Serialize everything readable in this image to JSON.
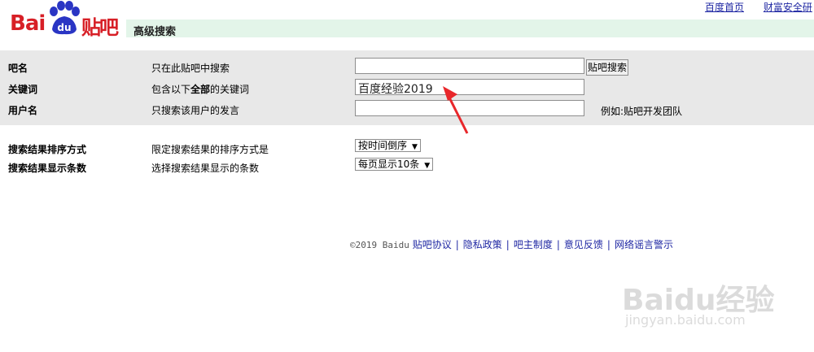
{
  "top_links": {
    "home": "百度首页",
    "security": "财富安全研"
  },
  "logo": {
    "text_left": "Bai",
    "text_paw": "du",
    "text_right": "贴吧"
  },
  "header": {
    "title": "高级搜索"
  },
  "form": {
    "rows": [
      {
        "label": "吧名",
        "desc": "只在此贴吧中搜索",
        "value": "",
        "button": "贴吧搜索"
      },
      {
        "label": "关键词",
        "desc_prefix": "包含以下",
        "desc_bold": "全部",
        "desc_suffix": "的关键词",
        "value": "百度经验2019"
      },
      {
        "label": "用户名",
        "desc": "只搜索该用户的发言",
        "value": "",
        "hint": "例如:贴吧开发团队"
      }
    ],
    "sort": {
      "label": "搜索结果排序方式",
      "desc": "限定搜索结果的排序方式是",
      "selected": "按时间倒序"
    },
    "count": {
      "label": "搜索结果显示条数",
      "desc": "选择搜索结果显示的条数",
      "selected": "每页显示10条"
    }
  },
  "footer": {
    "copyright": "©2019 Baidu",
    "links": [
      "贴吧协议",
      "隐私政策",
      "吧主制度",
      "意见反馈",
      "网络谣言警示"
    ]
  },
  "watermark": {
    "brand": "Baidu经验",
    "url": "jingyan.baidu.com"
  },
  "colors": {
    "logo_red": "#d71f26",
    "link_blue": "#1f27a3",
    "band_green": "#e3f5e9",
    "arrow_red": "#e8272b"
  }
}
